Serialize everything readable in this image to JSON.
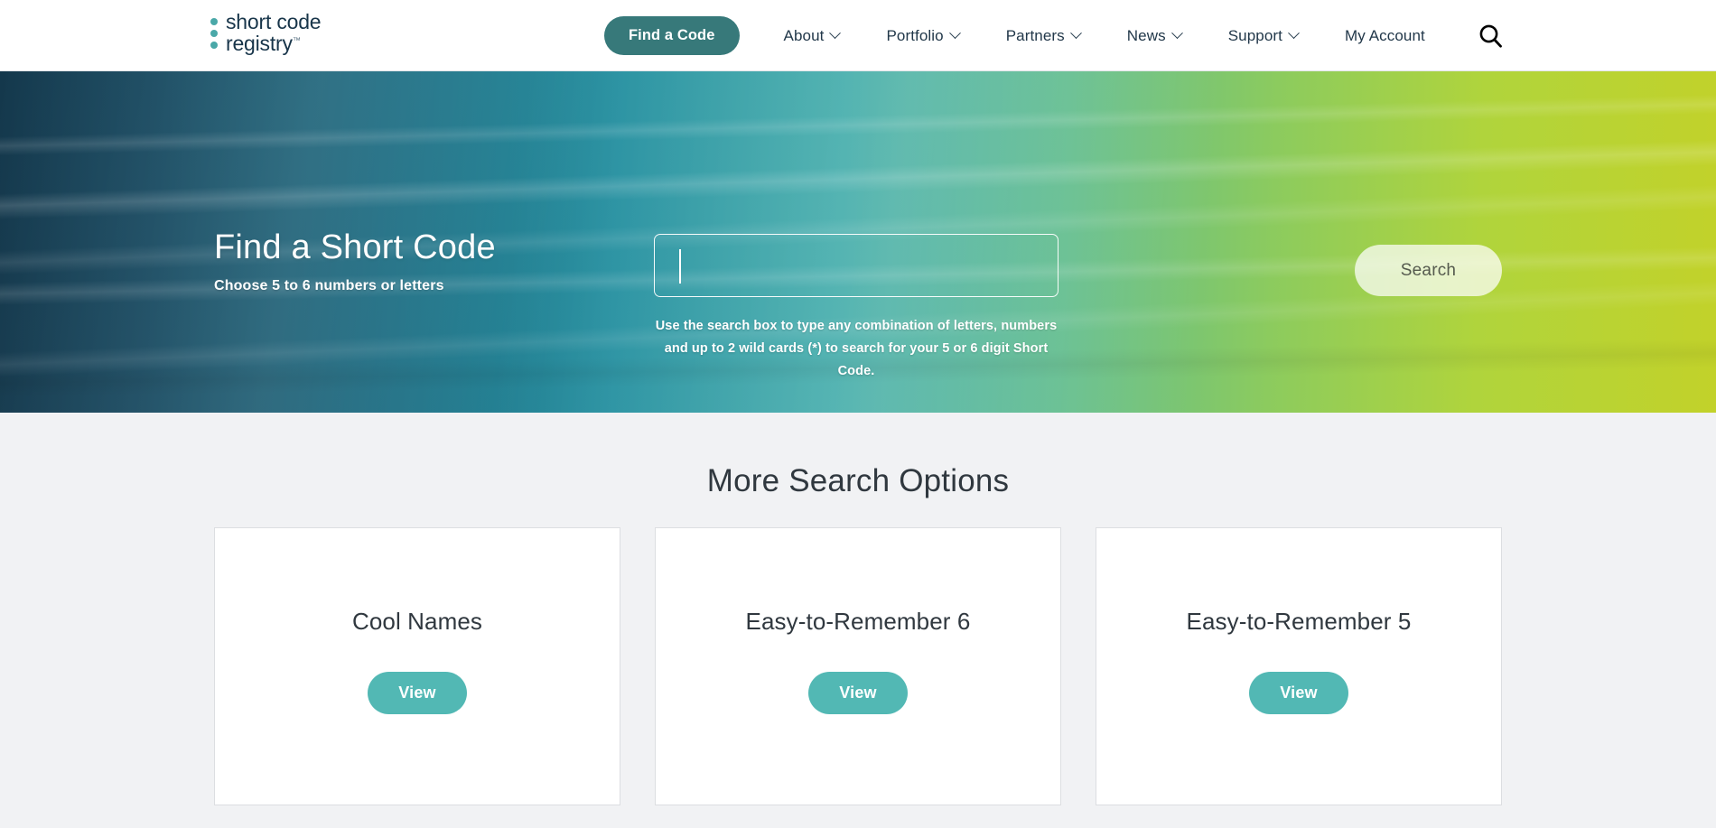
{
  "header": {
    "logo": {
      "line1": "short code",
      "line2": "registry",
      "trademark": "™",
      "dot_color": "#4aa8a8",
      "text_color": "#18354a"
    },
    "nav": {
      "cta_label": "Find a Code",
      "cta_color": "#37797a",
      "items": [
        {
          "label": "About",
          "has_chevron": true
        },
        {
          "label": "Portfolio",
          "has_chevron": true
        },
        {
          "label": "Partners",
          "has_chevron": true
        },
        {
          "label": "News",
          "has_chevron": true
        },
        {
          "label": "Support",
          "has_chevron": true
        },
        {
          "label": "My Account",
          "has_chevron": false
        }
      ]
    },
    "search_icon": "search-icon"
  },
  "hero": {
    "title": "Find a Short Code",
    "subtitle": "Choose 5 to 6 numbers or letters",
    "search": {
      "value": "",
      "placeholder": ""
    },
    "help_text": "Use the search box to type any combination of letters, numbers and up to 2 wild cards (*) to search for your 5 or 6 digit Short Code.",
    "search_button_label": "Search",
    "gradient_start": "#14384c",
    "gradient_mid": "#39a8a6",
    "gradient_end": "#c2d22a"
  },
  "main": {
    "section_title": "More Search Options",
    "cards": [
      {
        "title": "Cool Names",
        "button_label": "View"
      },
      {
        "title": "Easy-to-Remember 6",
        "button_label": "View"
      },
      {
        "title": "Easy-to-Remember 5",
        "button_label": "View"
      }
    ],
    "card_button_color": "#52b8b4",
    "background": "#f1f2f4"
  }
}
